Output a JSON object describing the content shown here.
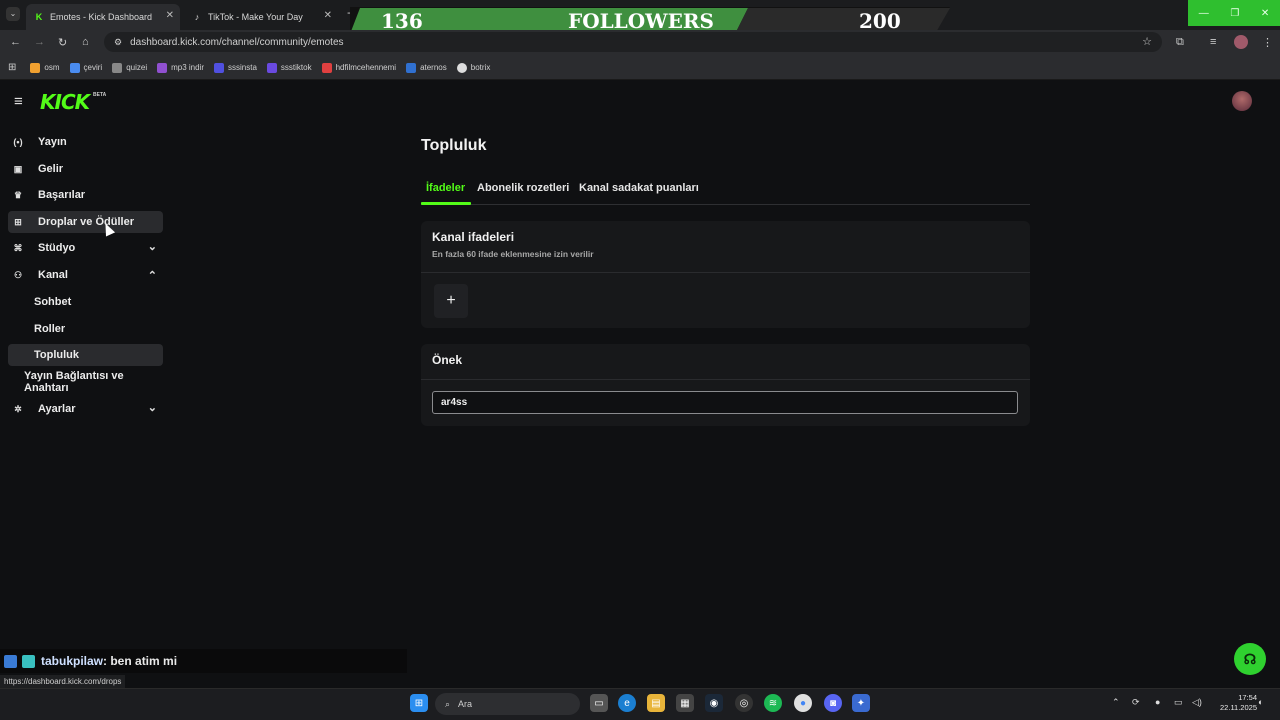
{
  "browser": {
    "tabs": [
      {
        "title": "Emotes - Kick Dashboard",
        "icon": "kick-icon"
      },
      {
        "title": "TikTok - Make Your Day",
        "icon": "tiktok-icon"
      }
    ],
    "new_tab": "+",
    "url": "dashboard.kick.com/channel/community/emotes",
    "bookmarks": [
      {
        "label": "osm",
        "color": "#f0a030"
      },
      {
        "label": "çeviri",
        "color": "#4a8cf0"
      },
      {
        "label": "quizei",
        "color": "#888888"
      },
      {
        "label": "mp3 indir",
        "color": "#9050d0"
      },
      {
        "label": "sssinsta",
        "color": "#5050e0"
      },
      {
        "label": "ssstiktok",
        "color": "#6a4ae0"
      },
      {
        "label": "hdfilmcehennemi",
        "color": "#e04040"
      },
      {
        "label": "aternos",
        "color": "#3070d0"
      },
      {
        "label": "botrix",
        "color": "#dddddd"
      }
    ],
    "status_url": "https://dashboard.kick.com/drops"
  },
  "overlay": {
    "current": "136",
    "label": "FOLLOWERS",
    "goal": "200"
  },
  "app": {
    "logo": "KICK",
    "logo_badge": "BETA",
    "accent": "#53fc18",
    "sidebar": {
      "items": [
        {
          "label": "Yayın",
          "icon": "broadcast-icon"
        },
        {
          "label": "Gelir",
          "icon": "revenue-icon"
        },
        {
          "label": "Başarılar",
          "icon": "trophy-icon"
        },
        {
          "label": "Droplar ve Ödüller",
          "icon": "gift-icon"
        },
        {
          "label": "Stüdyo",
          "icon": "studio-icon"
        },
        {
          "label": "Kanal",
          "icon": "channel-icon"
        },
        {
          "label": "Ayarlar",
          "icon": "gear-icon"
        }
      ],
      "sub_items": [
        {
          "label": "Sohbet"
        },
        {
          "label": "Roller"
        },
        {
          "label": "Topluluk"
        },
        {
          "label": "Yayın Bağlantısı ve Anahtarı"
        }
      ]
    },
    "main": {
      "title": "Topluluk",
      "tabs": [
        {
          "label": "İfadeler"
        },
        {
          "label": "Abonelik rozetleri"
        },
        {
          "label": "Kanal sadakat puanları"
        }
      ],
      "emotes_card": {
        "title": "Kanal ifadeleri",
        "subtitle": "En fazla 60 ifade eklenmesine izin verilir",
        "add": "+"
      },
      "prefix_card": {
        "title": "Önek",
        "value": "ar4ss"
      }
    },
    "chat_overlay": {
      "user": "tabukpilaw",
      "message": ": ben atim mi"
    }
  },
  "taskbar": {
    "search_placeholder": "Ara",
    "time": "17:54",
    "date": "22.11.2025"
  }
}
